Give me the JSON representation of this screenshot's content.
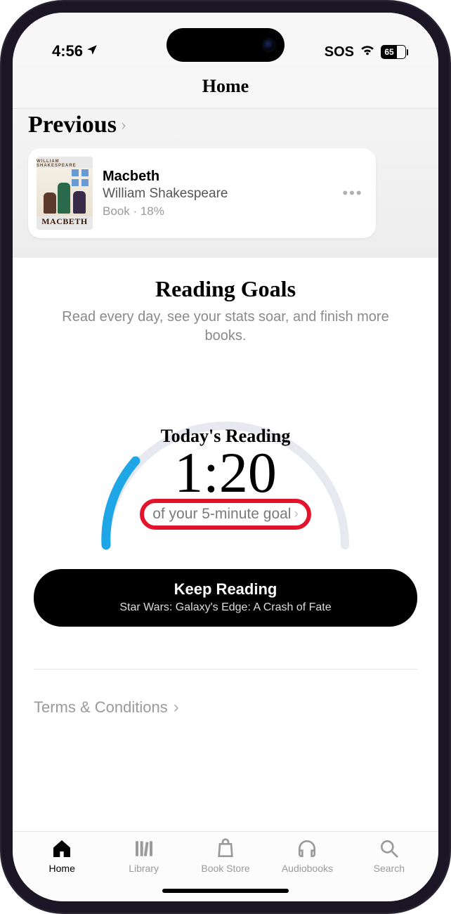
{
  "status": {
    "time": "4:56",
    "sos": "SOS",
    "battery_pct": "65"
  },
  "header": {
    "title": "Home"
  },
  "previous": {
    "section_label": "Previous",
    "cover_top": "WILLIAM SHAKESPEARE",
    "cover_bottom": "MACBETH",
    "book_title": "Macbeth",
    "author": "William Shakespeare",
    "subline": "Book · 18%"
  },
  "goals": {
    "title": "Reading Goals",
    "subtitle": "Read every day, see your stats soar, and finish more books.",
    "today_label": "Today's Reading",
    "time": "1:20",
    "goal_text": "of your 5-minute goal",
    "keep_reading_label": "Keep Reading",
    "keep_reading_sub": "Star Wars: Galaxy's Edge: A Crash of Fate"
  },
  "footer": {
    "terms": "Terms & Conditions"
  },
  "tabs": {
    "home": "Home",
    "library": "Library",
    "bookstore": "Book Store",
    "audiobooks": "Audiobooks",
    "search": "Search"
  }
}
